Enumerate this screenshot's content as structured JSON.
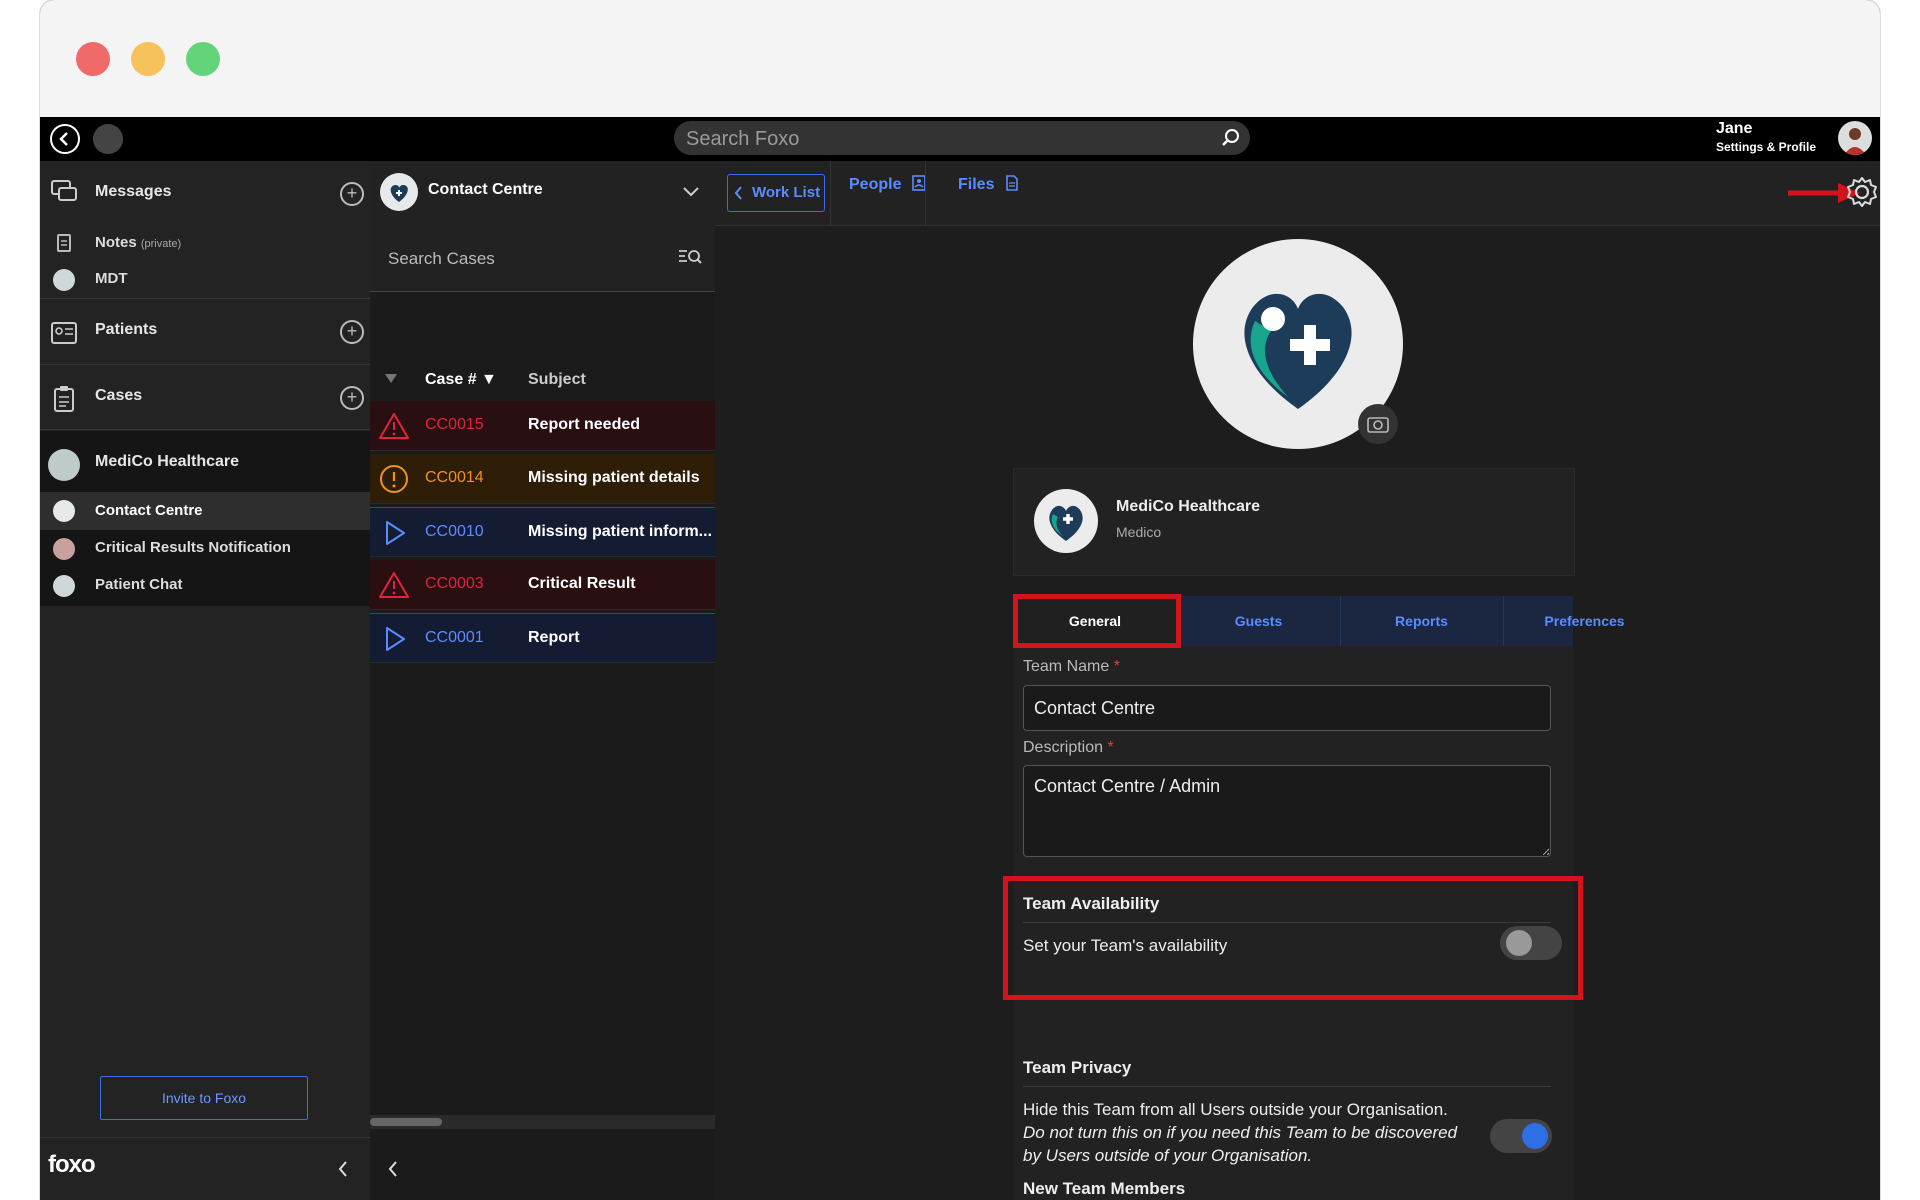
{
  "topbar": {
    "search_placeholder": "Search Foxo",
    "user_name": "Jane",
    "user_subtitle": "Settings & Profile"
  },
  "sidebar": {
    "messages": "Messages",
    "notes": "Notes",
    "notes_tag": "(private)",
    "mdt": "MDT",
    "patients": "Patients",
    "cases": "Cases",
    "org": "MediCo Healthcare",
    "teams": [
      "Contact Centre",
      "Critical Results Notification",
      "Patient Chat"
    ],
    "invite_label": "Invite to Foxo",
    "brand": "foxo"
  },
  "cases_panel": {
    "team_title": "Contact Centre",
    "search_placeholder": "Search Cases",
    "col_case": "Case #",
    "col_subject": "Subject",
    "rows": [
      {
        "num": "CC0015",
        "subject": "Report needed",
        "type": "critical"
      },
      {
        "num": "CC0014",
        "subject": "Missing patient details",
        "type": "warning"
      },
      {
        "num": "CC0010",
        "subject": "Missing patient inform...",
        "type": "info"
      },
      {
        "num": "CC0003",
        "subject": "Critical Result",
        "type": "critical"
      },
      {
        "num": "CC0001",
        "subject": "Report",
        "type": "info"
      }
    ]
  },
  "main": {
    "worklist": "Work List",
    "people": "People",
    "files": "Files",
    "org_name": "MediCo Healthcare",
    "org_sub": "Medico",
    "tabs": [
      "General",
      "Guests",
      "Reports",
      "Preferences"
    ],
    "team_name_label": "Team Name",
    "team_name_value": "Contact Centre",
    "description_label": "Description",
    "description_value": "Contact Centre / Admin",
    "availability_title": "Team Availability",
    "availability_text": "Set your Team's availability",
    "availability_on": false,
    "privacy_title": "Team Privacy",
    "privacy_text": "Hide this Team from all Users outside your Organisation.",
    "privacy_note": "Do not turn this on if you need this Team to be discovered by Users outside of your Organisation.",
    "privacy_on": true,
    "new_members_title": "New Team Members"
  },
  "colors": {
    "accent": "#5b8cff",
    "critical": "#e0243c",
    "warning": "#f0921e",
    "highlight": "#d4141c"
  }
}
